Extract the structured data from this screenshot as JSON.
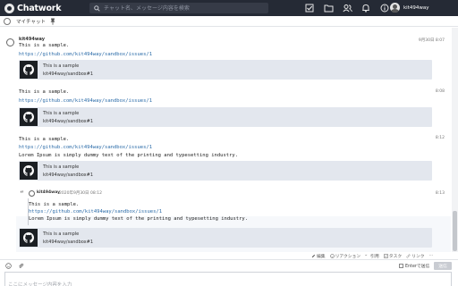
{
  "app": {
    "name": "Chatwork"
  },
  "search": {
    "placeholder": "チャット名、メッセージ内容を検索"
  },
  "user": {
    "name": "kit494way"
  },
  "room": {
    "name": "マイチャット"
  },
  "messages": [
    {
      "sender": "kit494way",
      "time": "9月30日 8:07",
      "lines": [
        "This is a sample."
      ],
      "link": "https://github.com/kit494way/sandbox/issues/1",
      "card": {
        "title": "This is a sample",
        "desc": "kit494way/sandbox#1"
      }
    },
    {
      "time": "8:08",
      "lines": [
        "This is a sample."
      ],
      "link": "https://github.com/kit494way/sandbox/issues/1",
      "card": {
        "title": "This is a sample",
        "desc": "kit494way/sandbox#1"
      }
    },
    {
      "time": "8:12",
      "lines": [
        "This is a sample."
      ],
      "link": "https://github.com/kit494way/sandbox/issues/1",
      "extra": "Lorem Ipsum is simply dummy text of the printing and typesetting industry.",
      "card": {
        "title": "This is a sample",
        "desc": "kit494way/sandbox#1"
      }
    },
    {
      "time": "8:13",
      "quote": {
        "name": "kit494way",
        "date": "2020年9月30日 08:12"
      },
      "lines": [
        "This is a sample."
      ],
      "link": "https://github.com/kit494way/sandbox/issues/1",
      "extra": "Lorem Ipsum is simply dummy text of the printing and typesetting industry.",
      "card": {
        "title": "This is a sample",
        "desc": "kit494way/sandbox#1"
      }
    }
  ],
  "actions": [
    "編集",
    "リアクション",
    "引用",
    "タスク",
    "リンク"
  ],
  "composer": {
    "placeholder": "ここにメッセージ内容を入力",
    "enter_send": "Enterで送信",
    "send_label": "送信"
  }
}
